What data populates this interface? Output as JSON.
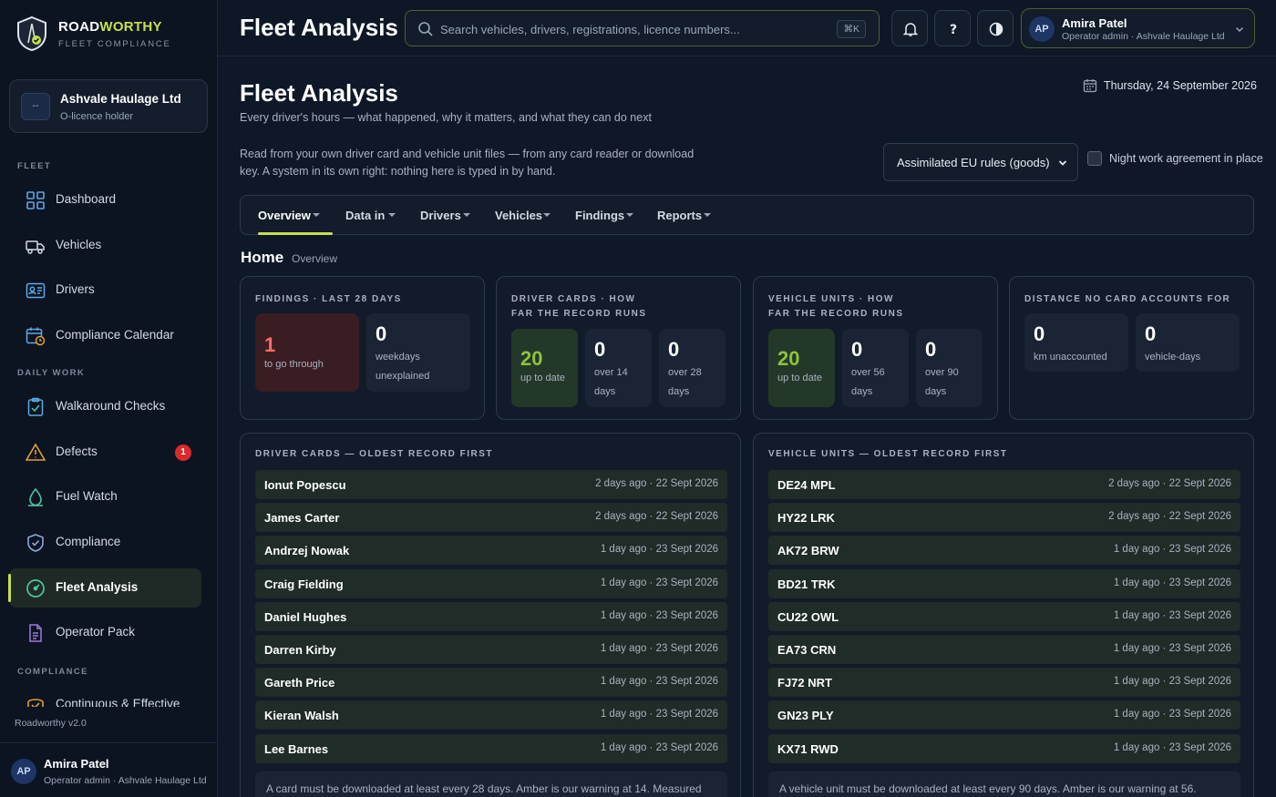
{
  "brand": {
    "name_a": "ROAD",
    "name_b": "WORTHY",
    "subtitle": "FLEET COMPLIANCE"
  },
  "org": {
    "icon_text": "--",
    "name": "Ashvale Haulage Ltd",
    "role": "O-licence holder"
  },
  "sidebar": {
    "sections": {
      "fleet": "FLEET",
      "daily": "DAILY WORK",
      "compliance": "COMPLIANCE"
    },
    "items": [
      {
        "label": "Dashboard",
        "icon": "dashboard-icon"
      },
      {
        "label": "Vehicles",
        "icon": "truck-icon"
      },
      {
        "label": "Drivers",
        "icon": "id-card-icon"
      },
      {
        "label": "Compliance Calendar",
        "icon": "calendar-clock-icon"
      },
      {
        "label": "Walkaround Checks",
        "icon": "clipboard-check-icon"
      },
      {
        "label": "Defects",
        "icon": "warning-icon",
        "badge": "1"
      },
      {
        "label": "Fuel Watch",
        "icon": "fuel-drop-icon"
      },
      {
        "label": "Compliance",
        "icon": "shield-icon"
      },
      {
        "label": "Fleet Analysis",
        "icon": "gauge-icon",
        "active": true
      },
      {
        "label": "Operator Pack",
        "icon": "document-icon"
      },
      {
        "label": "Continuous & Effective",
        "icon": "badge-icon"
      }
    ],
    "version": "Roadworthy v2.0"
  },
  "user": {
    "initials": "AP",
    "name": "Amira Patel",
    "role": "Operator admin · Ashvale Haulage Ltd"
  },
  "topbar": {
    "title": "Fleet Analysis",
    "search_placeholder": "Search vehicles, drivers, registrations, licence numbers...",
    "search_shortcut": "⌘K"
  },
  "page": {
    "title": "Fleet Analysis",
    "subtitle": "Every driver's hours — what happened, why it matters, and what they can do next",
    "date": "Thursday, 24 September 2026",
    "intro": "Read from your own driver card and vehicle unit files — from any card reader or download key. A system in its own right: nothing here is typed in by hand.",
    "rules_selected": "Assimilated EU rules (goods)",
    "night_work_label": "Night work agreement in place",
    "night_work_checked": false
  },
  "tabs": [
    "Overview",
    "Data in",
    "Drivers",
    "Vehicles",
    "Findings",
    "Reports"
  ],
  "breadcrumb": {
    "home": "Home",
    "current": "Overview"
  },
  "cards": {
    "findings": {
      "label": "FINDINGS · LAST 28 DAYS",
      "stats": [
        {
          "value": "1",
          "label": "to go through"
        },
        {
          "value": "0",
          "label": "weekdays unexplained"
        }
      ]
    },
    "driver_cards": {
      "label": "DRIVER CARDS · HOW FAR THE RECORD RUNS",
      "stats": [
        {
          "value": "20",
          "label": "up to date"
        },
        {
          "value": "0",
          "label": "over 14 days"
        },
        {
          "value": "0",
          "label": "over 28 days"
        }
      ]
    },
    "vehicle_units": {
      "label": "VEHICLE UNITS · HOW FAR THE RECORD RUNS",
      "stats": [
        {
          "value": "20",
          "label": "up to date"
        },
        {
          "value": "0",
          "label": "over 56 days"
        },
        {
          "value": "0",
          "label": "over 90 days"
        }
      ]
    },
    "distance": {
      "label": "DISTANCE NO CARD ACCOUNTS FOR",
      "stats": [
        {
          "value": "0",
          "label": "km unaccounted"
        },
        {
          "value": "0",
          "label": "vehicle-days"
        }
      ]
    }
  },
  "driver_list": {
    "title": "DRIVER CARDS — OLDEST RECORD FIRST",
    "rows": [
      {
        "name": "Ionut Popescu",
        "when": "2 days ago · 22 Sept 2026"
      },
      {
        "name": "James Carter",
        "when": "2 days ago · 22 Sept 2026"
      },
      {
        "name": "Andrzej Nowak",
        "when": "1 day ago · 23 Sept 2026"
      },
      {
        "name": "Craig Fielding",
        "when": "1 day ago · 23 Sept 2026"
      },
      {
        "name": "Daniel Hughes",
        "when": "1 day ago · 23 Sept 2026"
      },
      {
        "name": "Darren Kirby",
        "when": "1 day ago · 23 Sept 2026"
      },
      {
        "name": "Gareth Price",
        "when": "1 day ago · 23 Sept 2026"
      },
      {
        "name": "Kieran Walsh",
        "when": "1 day ago · 23 Sept 2026"
      },
      {
        "name": "Lee Barnes",
        "when": "1 day ago · 23 Sept 2026"
      }
    ],
    "note": "A card must be downloaded at least every 28 days. Amber is our warning at 14. Measured"
  },
  "vehicle_list": {
    "title": "VEHICLE UNITS — OLDEST RECORD FIRST",
    "rows": [
      {
        "name": "DE24 MPL",
        "when": "2 days ago · 22 Sept 2026"
      },
      {
        "name": "HY22 LRK",
        "when": "2 days ago · 22 Sept 2026"
      },
      {
        "name": "AK72 BRW",
        "when": "1 day ago · 23 Sept 2026"
      },
      {
        "name": "BD21 TRK",
        "when": "1 day ago · 23 Sept 2026"
      },
      {
        "name": "CU22 OWL",
        "when": "1 day ago · 23 Sept 2026"
      },
      {
        "name": "EA73 CRN",
        "when": "1 day ago · 23 Sept 2026"
      },
      {
        "name": "FJ72 NRT",
        "when": "1 day ago · 23 Sept 2026"
      },
      {
        "name": "GN23 PLY",
        "when": "1 day ago · 23 Sept 2026"
      },
      {
        "name": "KX71 RWD",
        "when": "1 day ago · 23 Sept 2026"
      }
    ],
    "note": "A vehicle unit must be downloaded at least every 90 days. Amber is our warning at 56."
  },
  "colors": {
    "accent": "#c7e04a",
    "danger": "#d92b2b",
    "good": "#8fc23a"
  }
}
